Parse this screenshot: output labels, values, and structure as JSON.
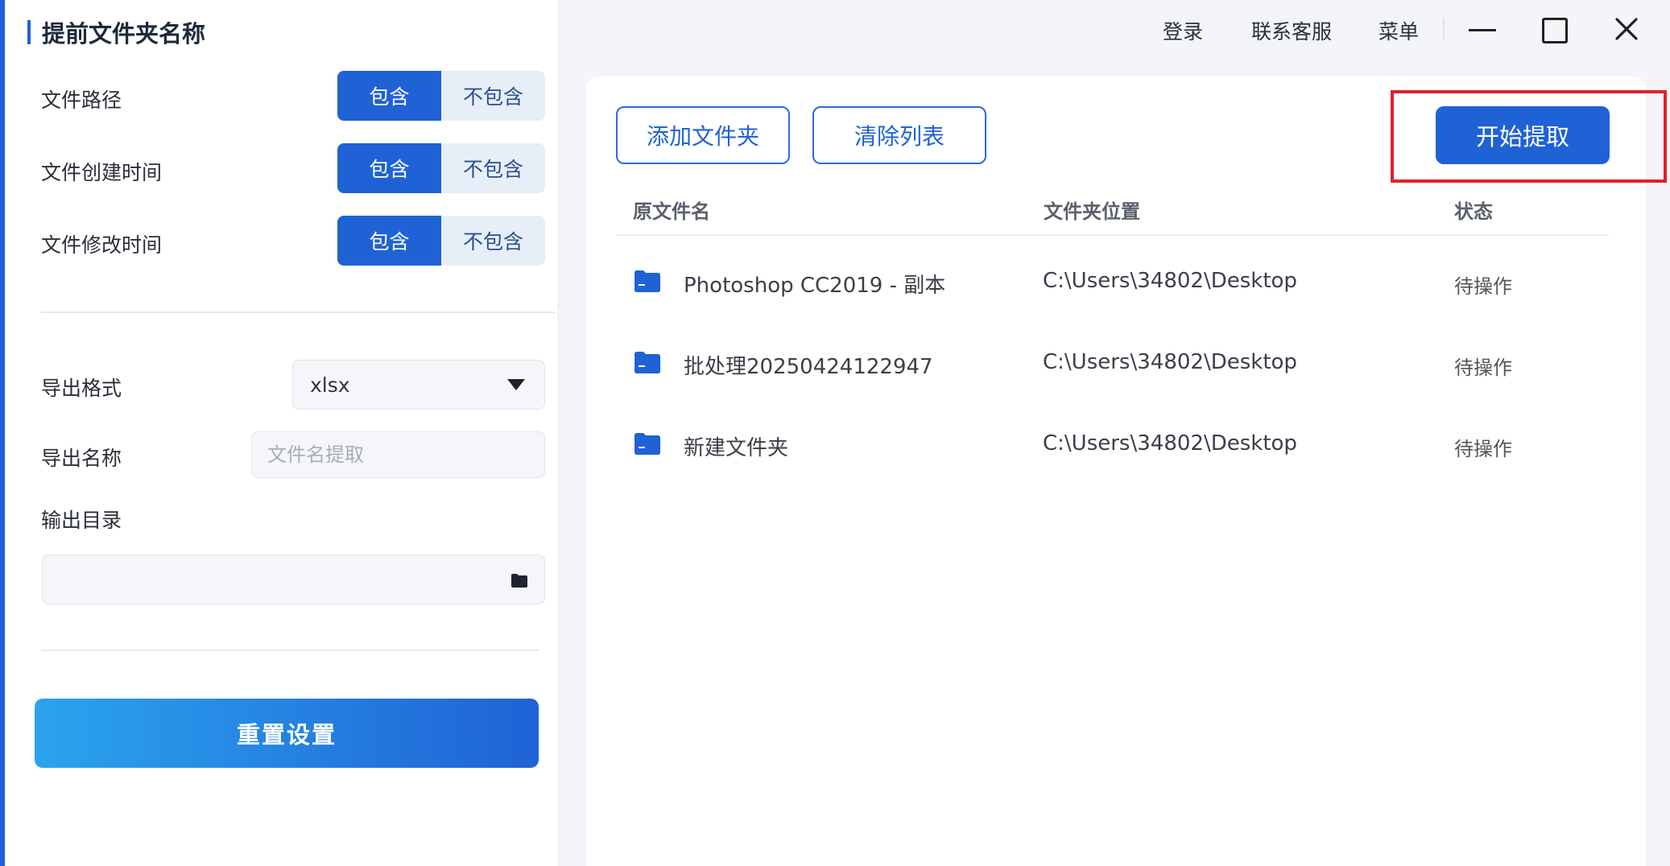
{
  "sidebar": {
    "title": "提前文件夹名称",
    "options": [
      {
        "label": "文件路径",
        "on": "包含",
        "off": "不包含"
      },
      {
        "label": "文件创建时间",
        "on": "包含",
        "off": "不包含"
      },
      {
        "label": "文件修改时间",
        "on": "包含",
        "off": "不包含"
      }
    ],
    "export_format_label": "导出格式",
    "export_format_value": "xlsx",
    "export_name_label": "导出名称",
    "export_name_placeholder": "文件名提取",
    "output_dir_label": "输出目录",
    "reset_label": "重置设置"
  },
  "titlebar": {
    "login": "登录",
    "support": "联系客服",
    "menu": "菜单"
  },
  "toolbar": {
    "add_folder": "添加文件夹",
    "clear_list": "清除列表",
    "start": "开始提取"
  },
  "table": {
    "columns": [
      "原文件名",
      "文件夹位置",
      "状态"
    ],
    "rows": [
      {
        "name": "Photoshop CC2019 - 副本",
        "location": "C:\\Users\\34802\\Desktop",
        "status": "待操作"
      },
      {
        "name": "批处理20250424122947",
        "location": "C:\\Users\\34802\\Desktop",
        "status": "待操作"
      },
      {
        "name": "新建文件夹",
        "location": "C:\\Users\\34802\\Desktop",
        "status": "待操作"
      }
    ]
  },
  "colors": {
    "primary": "#1f62d6",
    "highlight": "#e0202a"
  }
}
